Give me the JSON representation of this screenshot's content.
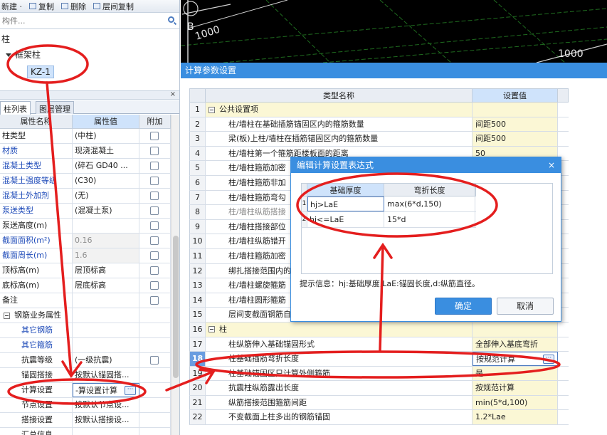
{
  "left_panel": {
    "toolbar": {
      "new_label": "新建 ·",
      "copy_label": "复制",
      "delete_label": "删除",
      "floor_copy_label": "层间复制"
    },
    "search": {
      "placeholder": "构件..."
    },
    "tree": {
      "root": "柱",
      "node": "框架柱",
      "leaf": "KZ-1"
    },
    "tabs": [
      "柱列表",
      "图层管理"
    ],
    "prop_headers": {
      "name": "属性名称",
      "value": "属性值",
      "add": "附加"
    },
    "props": [
      {
        "name": "柱类型",
        "value": "(中柱)"
      },
      {
        "name": "材质",
        "value": "现浇混凝土"
      },
      {
        "name": "混凝土类型",
        "value": "(碎石 GD40 ..."
      },
      {
        "name": "混凝土强度等级",
        "value": "(C30)"
      },
      {
        "name": "混凝土外加剂",
        "value": "(无)"
      },
      {
        "name": "泵送类型",
        "value": "(混凝土泵)"
      },
      {
        "name": "泵送高度(m)",
        "value": ""
      },
      {
        "name": "截面面积(m²)",
        "value": "0.16"
      },
      {
        "name": "截面周长(m)",
        "value": "1.6"
      },
      {
        "name": "顶标高(m)",
        "value": "层顶标高"
      },
      {
        "name": "底标高(m)",
        "value": "层底标高"
      },
      {
        "name": "备注",
        "value": ""
      },
      {
        "name": "钢筋业务属性",
        "value": ""
      },
      {
        "name": "其它钢筋",
        "value": ""
      },
      {
        "name": "其它箍筋",
        "value": ""
      },
      {
        "name": "抗震等级",
        "value": "(一级抗震)"
      },
      {
        "name": "锚固搭接",
        "value": "按默认锚固搭..."
      },
      {
        "name": "计算设置",
        "value": "-算设置计算"
      },
      {
        "name": "节点设置",
        "value": "按默认节点设..."
      },
      {
        "name": "搭接设置",
        "value": "按默认搭接设..."
      },
      {
        "name": "汇总信息",
        "value": ""
      }
    ],
    "ellipsis": "···",
    "close_glyph": "×"
  },
  "cad": {
    "labels": [
      "B",
      "1000",
      "1000"
    ]
  },
  "calc_dialog": {
    "title": "计算参数设置",
    "headers": {
      "name": "类型名称",
      "value": "设置值"
    },
    "rows": [
      {
        "num": "1",
        "name": "公共设置项",
        "value": ""
      },
      {
        "num": "2",
        "name": "柱/墙柱在基础插筋锚固区内的箍筋数量",
        "value": "间距500"
      },
      {
        "num": "3",
        "name": "梁(板)上柱/墙柱在插筋锚固区内的箍筋数量",
        "value": "间距500"
      },
      {
        "num": "4",
        "name": "柱/墙柱第一个箍筋距楼板面的距离",
        "value": "50"
      },
      {
        "num": "5",
        "name": "柱/墙柱箍筋加密",
        "value": ""
      },
      {
        "num": "6",
        "name": "柱/墙柱箍筋非加",
        "value": ""
      },
      {
        "num": "7",
        "name": "柱/墙柱箍筋弯勾",
        "value": ""
      },
      {
        "num": "8",
        "name": "柱/墙柱纵筋搭接",
        "value": ""
      },
      {
        "num": "9",
        "name": "柱/墙柱搭接部位",
        "value": ""
      },
      {
        "num": "10",
        "name": "柱/墙柱纵筋错开",
        "value": ""
      },
      {
        "num": "11",
        "name": "柱/墙柱箍筋加密",
        "value": ""
      },
      {
        "num": "12",
        "name": "绑扎搭接范围内的",
        "value": ""
      },
      {
        "num": "13",
        "name": "柱/墙柱螺旋箍筋",
        "value": ""
      },
      {
        "num": "14",
        "name": "柱/墙柱圆形箍筋",
        "value": ""
      },
      {
        "num": "15",
        "name": "层间变截面钢筋自",
        "value": ""
      },
      {
        "num": "16",
        "name": "柱",
        "value": ""
      },
      {
        "num": "17",
        "name": "柱纵筋伸入基础锚固形式",
        "value": "全部伸入基底弯折"
      },
      {
        "num": "18",
        "name": "柱基础插筋弯折长度",
        "value": "按规范计算"
      },
      {
        "num": "19",
        "name": "柱基础锚固区只计算外侧箍筋",
        "value": "是"
      },
      {
        "num": "20",
        "name": "抗震柱纵筋露出长度",
        "value": "按规范计算"
      },
      {
        "num": "21",
        "name": "纵筋搭接范围箍筋间距",
        "value": "min(5*d,100)"
      },
      {
        "num": "22",
        "name": "不变截面上柱多出的钢筋锚固",
        "value": "1.2*Lae"
      }
    ]
  },
  "expr_dialog": {
    "title": "编辑计算设置表达式",
    "close": "×",
    "headers": {
      "a": "基础厚度",
      "b": "弯折长度"
    },
    "rows": [
      {
        "num": "1",
        "a": "hj>LaE",
        "b": "max(6*d,150)"
      },
      {
        "num": "2",
        "a": "hj<=LaE",
        "b": "15*d"
      }
    ],
    "hint": "提示信息：hj:基础厚度,LaE:锚固长度,d:纵筋直径。",
    "ok_label": "确定",
    "cancel_label": "取消"
  },
  "colors": {
    "title_bar": "#3a8ee0",
    "annotation_red": "#e41e1e",
    "selection_blue": "#cfe3fb",
    "section_yellow": "#fbf7d5"
  }
}
